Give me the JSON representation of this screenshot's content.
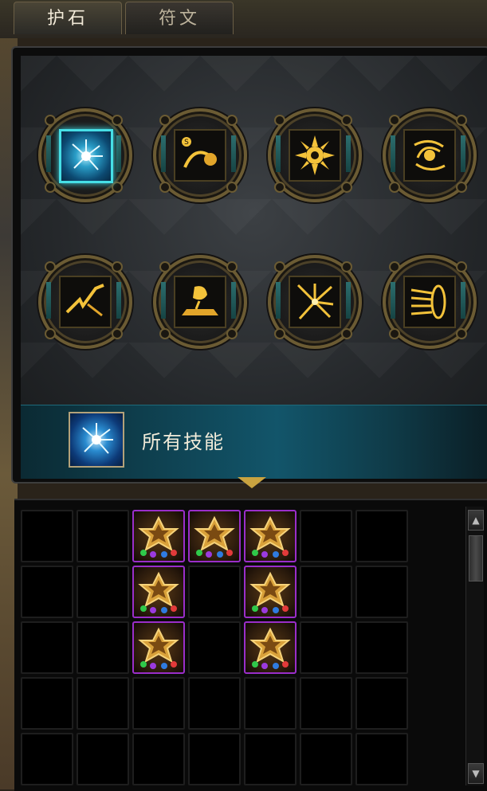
{
  "tabs": [
    {
      "label": "护石",
      "active": true
    },
    {
      "label": "符文",
      "active": false
    }
  ],
  "skills": [
    {
      "icon": "blue-vortex-icon",
      "selected": true
    },
    {
      "icon": "fire-arc-skill-icon",
      "selected": false
    },
    {
      "icon": "radiant-sun-icon",
      "selected": false
    },
    {
      "icon": "swirling-blast-icon",
      "selected": false
    },
    {
      "icon": "lightning-strike-icon",
      "selected": false
    },
    {
      "icon": "rock-crush-icon",
      "selected": false
    },
    {
      "icon": "spark-burst-icon",
      "selected": false
    },
    {
      "icon": "spiral-wave-icon",
      "selected": false
    }
  ],
  "description": {
    "icon": "blue-vortex-icon",
    "text": "所有技能"
  },
  "inventory": {
    "rows": 5,
    "cols": 8,
    "gems": [
      {
        "row": 0,
        "col": 2
      },
      {
        "row": 0,
        "col": 3
      },
      {
        "row": 0,
        "col": 4
      },
      {
        "row": 1,
        "col": 2
      },
      {
        "row": 1,
        "col": 4
      },
      {
        "row": 2,
        "col": 2
      },
      {
        "row": 2,
        "col": 4
      }
    ]
  },
  "colors": {
    "accent_teal": "#46dfe6",
    "gold": "#c9a340",
    "gem_border": "#9a2ec9"
  }
}
